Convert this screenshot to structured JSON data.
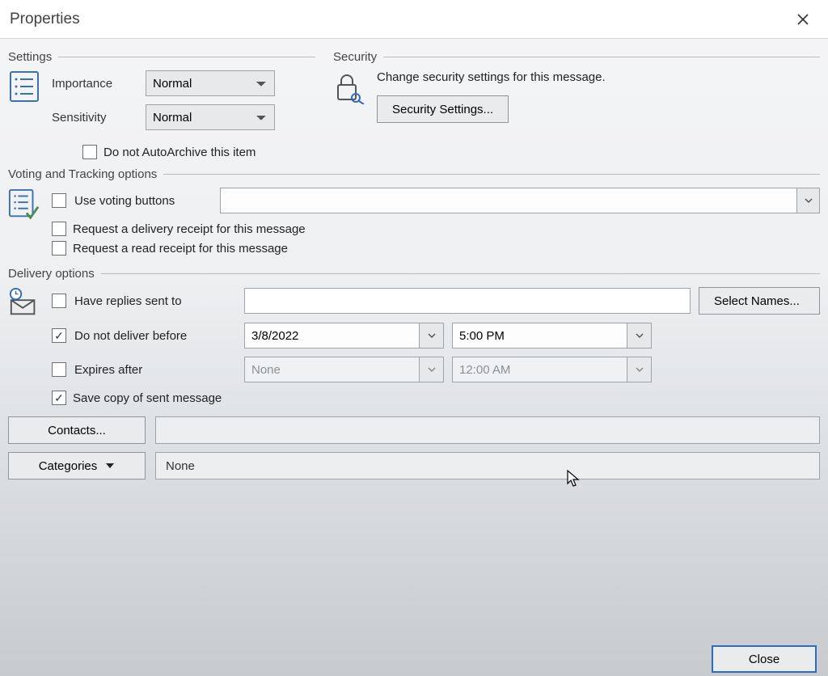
{
  "window": {
    "title": "Properties",
    "close_button": "Close"
  },
  "settings": {
    "group_title": "Settings",
    "importance_label": "Importance",
    "importance_value": "Normal",
    "sensitivity_label": "Sensitivity",
    "sensitivity_value": "Normal",
    "autoarchive_label": "Do not AutoArchive this item",
    "autoarchive_checked": false
  },
  "security": {
    "group_title": "Security",
    "description": "Change security settings for this message.",
    "button_label": "Security Settings..."
  },
  "voting": {
    "group_title": "Voting and Tracking options",
    "use_voting_label": "Use voting buttons",
    "use_voting_checked": false,
    "voting_value": "",
    "delivery_receipt_label": "Request a delivery receipt for this message",
    "delivery_receipt_checked": false,
    "read_receipt_label": "Request a read receipt for this message",
    "read_receipt_checked": false
  },
  "delivery": {
    "group_title": "Delivery options",
    "have_replies_label": "Have replies sent to",
    "have_replies_checked": false,
    "have_replies_value": "",
    "select_names_label": "Select Names...",
    "no_deliver_label": "Do not deliver before",
    "no_deliver_checked": true,
    "no_deliver_date": "3/8/2022",
    "no_deliver_time": "5:00 PM",
    "expires_label": "Expires after",
    "expires_checked": false,
    "expires_date": "None",
    "expires_time": "12:00 AM",
    "save_copy_label": "Save copy of sent message",
    "save_copy_checked": true
  },
  "bottom": {
    "contacts_button": "Contacts...",
    "contacts_value": "",
    "categories_button": "Categories",
    "categories_value": "None"
  }
}
